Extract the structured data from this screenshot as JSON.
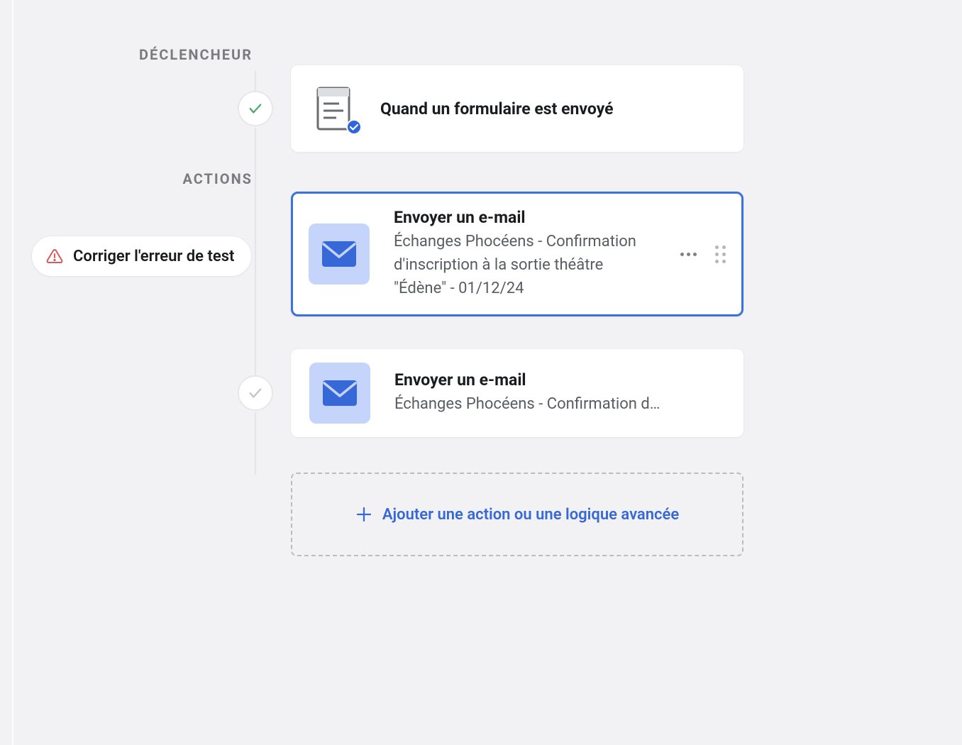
{
  "sections": {
    "trigger_label": "DÉCLENCHEUR",
    "actions_label": "ACTIONS"
  },
  "trigger": {
    "title": "Quand un formulaire est envoyé",
    "status": "success"
  },
  "error_pill": {
    "label": "Corriger l'erreur de test"
  },
  "actions": [
    {
      "title": "Envoyer un e-mail",
      "subtitle": "Échanges Phocéens - Confirmation d'inscription à la sortie théâtre \"Édène\" - 01/12/24",
      "selected": true,
      "icon": "email"
    },
    {
      "title": "Envoyer un e-mail",
      "subtitle": "Échanges Phocéens - Confirmation d…",
      "selected": false,
      "icon": "email",
      "status": "success"
    }
  ],
  "add_action": {
    "label": "Ajouter une action ou une logique avancée"
  },
  "colors": {
    "primary": "#3768d8",
    "selected_border": "#3973e0",
    "email_icon_bg": "#c5d4fb",
    "error": "#d85a5a"
  }
}
